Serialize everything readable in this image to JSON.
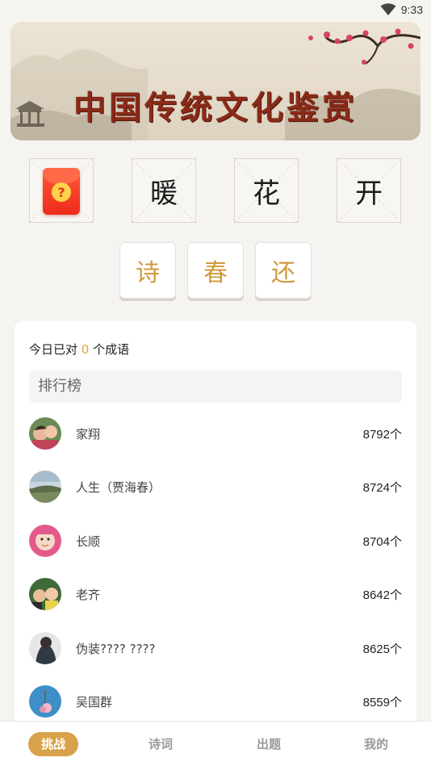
{
  "status_bar": {
    "time": "9:33",
    "wifi_icon": "wifi-icon"
  },
  "banner": {
    "title": "中国传统文化鉴赏"
  },
  "puzzle": {
    "hint_icon": "red-envelope-question-icon",
    "hint_mark": "?",
    "chars": [
      "暖",
      "花",
      "开"
    ]
  },
  "options": [
    "诗",
    "春",
    "还"
  ],
  "leaderboard": {
    "today_prefix": "今日已对",
    "today_count": "0",
    "today_suffix": "个成语",
    "header": "排行榜",
    "rows": [
      {
        "name": "家翔",
        "score": "8792个"
      },
      {
        "name": "人生（贾海春）",
        "score": "8724个"
      },
      {
        "name": "长顺",
        "score": "8704个"
      },
      {
        "name": "老齐",
        "score": "8642个"
      },
      {
        "name": "伪装???? ????",
        "score": "8625个"
      },
      {
        "name": "吴国群",
        "score": "8559个"
      }
    ]
  },
  "nav": {
    "challenge": "挑战",
    "poetry": "诗词",
    "make_question": "出题",
    "mine": "我的"
  },
  "colors": {
    "accent": "#d8a24a",
    "option_text": "#d19a3e",
    "banner_title": "#8a2a18",
    "background": "#f6f4f0"
  }
}
